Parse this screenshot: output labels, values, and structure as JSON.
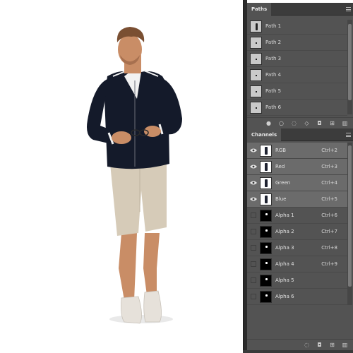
{
  "paths_panel": {
    "title": "Paths",
    "items": [
      {
        "label": "Path 1",
        "thumb": "figure-thumb"
      },
      {
        "label": "Path 2",
        "thumb": "dot-thumb"
      },
      {
        "label": "Path 3",
        "thumb": "dot-thumb"
      },
      {
        "label": "Path 4",
        "thumb": "dot-thumb"
      },
      {
        "label": "Path 5",
        "thumb": "dot-thumb"
      },
      {
        "label": "Path 6",
        "thumb": "dot-thumb"
      }
    ],
    "footer_icons": [
      "fill-path-icon",
      "stroke-path-icon",
      "load-selection-icon",
      "make-work-path-icon",
      "add-mask-icon",
      "new-path-icon",
      "delete-icon"
    ]
  },
  "channels_panel": {
    "title": "Channels",
    "items": [
      {
        "label": "RGB",
        "shortcut": "Ctrl+2",
        "visible": true,
        "selected": true,
        "thumb": "rgb"
      },
      {
        "label": "Red",
        "shortcut": "Ctrl+3",
        "visible": true,
        "selected": true,
        "thumb": "rgb"
      },
      {
        "label": "Green",
        "shortcut": "Ctrl+4",
        "visible": true,
        "selected": true,
        "thumb": "rgb"
      },
      {
        "label": "Blue",
        "shortcut": "Ctrl+5",
        "visible": true,
        "selected": true,
        "thumb": "rgb"
      },
      {
        "label": "Alpha 1",
        "shortcut": "Ctrl+6",
        "visible": false,
        "selected": false,
        "thumb": "alpha"
      },
      {
        "label": "Alpha 2",
        "shortcut": "Ctrl+7",
        "visible": false,
        "selected": false,
        "thumb": "alpha"
      },
      {
        "label": "Alpha 3",
        "shortcut": "Ctrl+8",
        "visible": false,
        "selected": false,
        "thumb": "alpha"
      },
      {
        "label": "Alpha 4",
        "shortcut": "Ctrl+9",
        "visible": false,
        "selected": false,
        "thumb": "alpha"
      },
      {
        "label": "Alpha 5",
        "shortcut": "",
        "visible": false,
        "selected": false,
        "thumb": "alpha"
      },
      {
        "label": "Alpha 6",
        "shortcut": "",
        "visible": false,
        "selected": false,
        "thumb": "alpha"
      }
    ],
    "footer_icons": [
      "load-selection-icon",
      "save-selection-icon",
      "new-channel-icon",
      "delete-icon"
    ]
  },
  "colors": {
    "panel_bg": "#535353",
    "panel_header": "#3c3c3c",
    "selected_row": "#6b6b6b",
    "canvas_bg": "#ffffff",
    "cardigan": "#141a2a",
    "shorts": "#d6cbb8"
  }
}
